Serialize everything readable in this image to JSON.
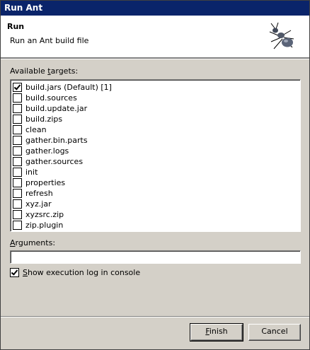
{
  "window": {
    "title": "Run Ant"
  },
  "banner": {
    "title": "Run",
    "description": "Run an Ant build file",
    "icon": "ant-icon"
  },
  "targets": {
    "label_pre": "Available ",
    "label_mnemonic": "t",
    "label_post": "argets:",
    "items": [
      {
        "label": "build.jars (Default) [1]",
        "checked": true
      },
      {
        "label": "build.sources",
        "checked": false
      },
      {
        "label": "build.update.jar",
        "checked": false
      },
      {
        "label": "build.zips",
        "checked": false
      },
      {
        "label": "clean",
        "checked": false
      },
      {
        "label": "gather.bin.parts",
        "checked": false
      },
      {
        "label": "gather.logs",
        "checked": false
      },
      {
        "label": "gather.sources",
        "checked": false
      },
      {
        "label": "init",
        "checked": false
      },
      {
        "label": "properties",
        "checked": false
      },
      {
        "label": "refresh",
        "checked": false
      },
      {
        "label": "xyz.jar",
        "checked": false
      },
      {
        "label": "xyzsrc.zip",
        "checked": false
      },
      {
        "label": "zip.plugin",
        "checked": false
      }
    ]
  },
  "arguments": {
    "label_mnemonic": "A",
    "label_post": "rguments:",
    "value": ""
  },
  "show_log": {
    "checked": true,
    "label_mnemonic": "S",
    "label_post": "how execution log in console"
  },
  "buttons": {
    "finish_mnemonic": "F",
    "finish_post": "inish",
    "cancel": "Cancel"
  }
}
